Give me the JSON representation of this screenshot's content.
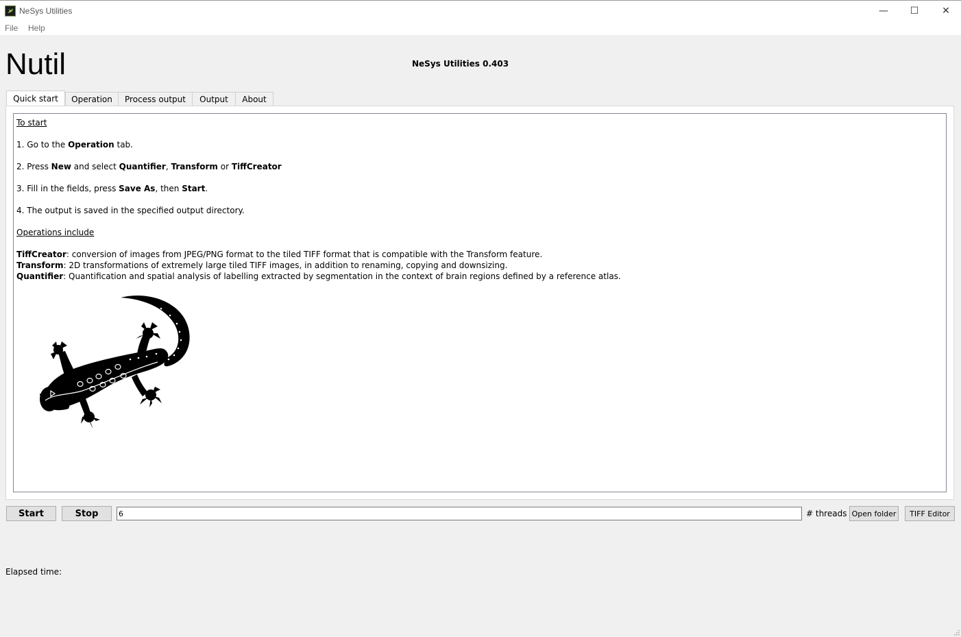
{
  "window": {
    "title": "NeSys Utilities",
    "controls": {
      "minimize": "—",
      "maximize": "☐",
      "close": "✕"
    }
  },
  "menu": [
    "File",
    "Help"
  ],
  "header": {
    "brand": "Nutil",
    "version": "NeSys Utilities 0.403"
  },
  "tabs": [
    "Quick start",
    "Operation",
    "Process output",
    "Output",
    "About"
  ],
  "quickstart": {
    "heading_start": "To start",
    "step1": {
      "a": "1. Go to the ",
      "b": "Operation",
      "c": " tab."
    },
    "step2": {
      "a": "2. Press ",
      "b": "New",
      "c": " and select ",
      "d": "Quantifier",
      "e": ", ",
      "f": "Transform",
      "g": " or ",
      "h": "TiffCreator"
    },
    "step3": {
      "a": "3. Fill in the fields, press ",
      "b": "Save As",
      "c": ", then ",
      "d": "Start",
      "e": "."
    },
    "step4": "4. The output is saved in the specified output directory.",
    "heading_ops": "Operations include",
    "ops": [
      {
        "name": "TiffCreator",
        "desc": ": conversion of images from JPEG/PNG format to the tiled TIFF format that is compatible with the Transform feature."
      },
      {
        "name": "Transform",
        "desc": ": 2D transformations of extremely large tiled TIFF images, in addition to renaming, copying and downsizing."
      },
      {
        "name": "Quantifier",
        "desc": ": Quantification and spatial analysis of labelling extracted by segmentation in the context of brain regions defined by a reference atlas."
      }
    ],
    "logo": "gecko-logo"
  },
  "controls": {
    "start": "Start",
    "stop": "Stop",
    "threads_value": "6",
    "threads_label": "# threads",
    "open_folder": "Open folder",
    "tiff_editor": "TIFF Editor"
  },
  "status": {
    "elapsed_label": "Elapsed time:"
  }
}
